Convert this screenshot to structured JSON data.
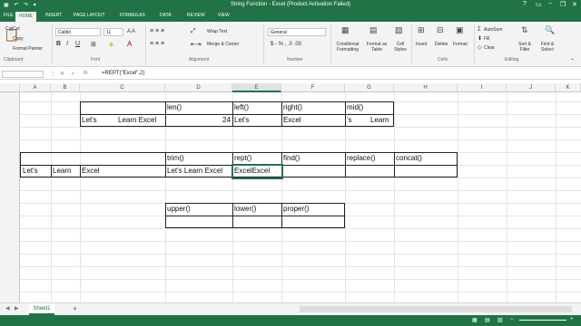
{
  "window": {
    "title": "String Function - Excel (Product Activation Failed)",
    "controls": [
      "?",
      "▭",
      "−",
      "❐",
      "✕"
    ]
  },
  "ribbon_tabs": [
    "FILE",
    "HOME",
    "INSERT",
    "PAGE LAYOUT",
    "FORMULAS",
    "DATA",
    "REVIEW",
    "VIEW"
  ],
  "clipboard": {
    "cut": "Cut",
    "copy": "Copy",
    "format_painter": "Format Painter",
    "group": "Clipboard"
  },
  "font": {
    "name": "Calibri",
    "size": "11",
    "group": "Font"
  },
  "alignment": {
    "wrap": "Wrap Text",
    "merge": "Merge & Center",
    "group": "Alignment"
  },
  "number": {
    "format": "General",
    "group": "Number",
    "symbols": "$ - % , .0 .00"
  },
  "styles": {
    "conditional": "Conditional Formatting",
    "format_table": "Format as Table",
    "cell_styles": "Cell Styles"
  },
  "cells": {
    "insert": "Insert",
    "delete": "Delete",
    "format": "Format",
    "group": "Cells"
  },
  "editing": {
    "autosum": "AutoSum",
    "fill": "Fill",
    "clear": "Clear",
    "sort": "Sort & Filter",
    "find": "Find & Select",
    "group": "Editing"
  },
  "formula_bar": {
    "fx": "fx",
    "formula": "=REPT(\"Excel\",2)"
  },
  "columns": [
    "A",
    "B",
    "C",
    "D",
    "E",
    "F",
    "G",
    "H",
    "I",
    "J",
    "K",
    "L"
  ],
  "cells_content": {
    "len_h": "len()",
    "left_h": "left()",
    "right_h": "right()",
    "mid_h": "mid()",
    "c_lets": "Let's",
    "d_learn_excel": "Learn Excel",
    "e_24": "24",
    "f_lets": "Let's",
    "g_excel": "Excel",
    "h_s": "'s",
    "h_learn": "Learn",
    "trim_h": "trim()",
    "rept_h": "rept()",
    "find_h": "find()",
    "replace_h": "replace()",
    "concat_h": "concat()",
    "a_lets": "Let's",
    "b_learn": "Learn",
    "c_excel": "Excel",
    "e_trim": "Let's Learn Excel",
    "f_rept": "ExcelExcel",
    "upper_h": "upper()",
    "lower_h": "lower()",
    "proper_h": "proper()"
  },
  "sheet": {
    "name": "Sheet1",
    "add": "+"
  }
}
